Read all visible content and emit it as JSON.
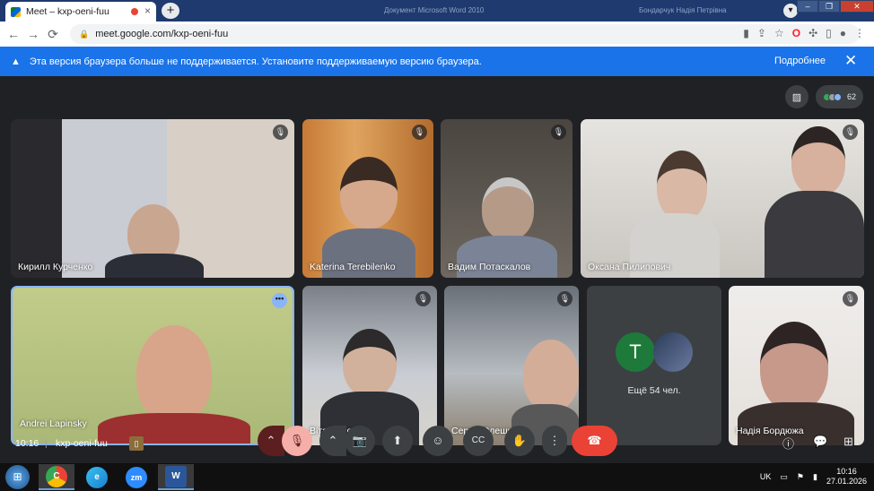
{
  "browser": {
    "tab_title": "Meet – kxp-oeni-fuu",
    "tab_close": "×",
    "new_tab": "+",
    "window_title": "Документ Microsoft Word 2010",
    "window_user": "Бондарчук Надія Петрівна",
    "url": "meet.google.com/kxp-oeni-fuu",
    "back_icon": "←",
    "forward_icon": "→",
    "reload_icon": "⟳",
    "lock_icon": "🔒",
    "minimize": "–",
    "maximize": "❐",
    "close": "✕",
    "chrome_menu": "⋮",
    "opera_icon": "O"
  },
  "infobar": {
    "message": "Эта версия браузера больше не поддерживается. Установите поддерживаемую версию браузера.",
    "more_label": "Подробнее",
    "warn_icon": "▲",
    "close_icon": "✕"
  },
  "meet": {
    "participant_count": "62",
    "participants": [
      {
        "name": "Кирилл Курченко",
        "mic": "muted"
      },
      {
        "name": "Katerina Terebilenko",
        "mic": "muted"
      },
      {
        "name": "Вадим Потаскалов",
        "mic": "muted"
      },
      {
        "name": "Оксана Пилипович",
        "mic": "muted"
      },
      {
        "name": "Andrei Lapinsky",
        "mic": "on"
      },
      {
        "name": "Віта Ворот...",
        "mic": "muted"
      },
      {
        "name": "Сергій Олешко...",
        "mic": "muted"
      },
      {
        "name": "Надія Бордюжа",
        "mic": "muted"
      }
    ],
    "others": {
      "avatar_letter": "T",
      "label": "Ещё 54 чел."
    },
    "more_options": "•••",
    "mic_off_icon": "🎙",
    "colors": {
      "accent": "#8ab4f8",
      "end_call": "#ea4335",
      "surface": "#202124",
      "tile_gray": "#3c4043"
    }
  },
  "controls": {
    "time": "10:16",
    "separator": "|",
    "meeting_code": "kxp-oeni-fuu",
    "arrow_up": "⌃",
    "mic": "🎙",
    "camera": "📷",
    "present": "⬆",
    "emoji": "☺",
    "captions": "CC",
    "hand": "✋",
    "more": "⋮",
    "end_call": "☎",
    "info": "ⓘ",
    "chat": "💬",
    "activities": "⊞"
  },
  "taskbar": {
    "start_icon": "⊞",
    "apps": [
      {
        "name": "chrome",
        "label": "C"
      },
      {
        "name": "edge",
        "label": "e"
      },
      {
        "name": "zoom",
        "label": "zm"
      },
      {
        "name": "word",
        "label": "W"
      }
    ],
    "lang": "UK",
    "time": "10:16",
    "date": "27.01.2026"
  }
}
